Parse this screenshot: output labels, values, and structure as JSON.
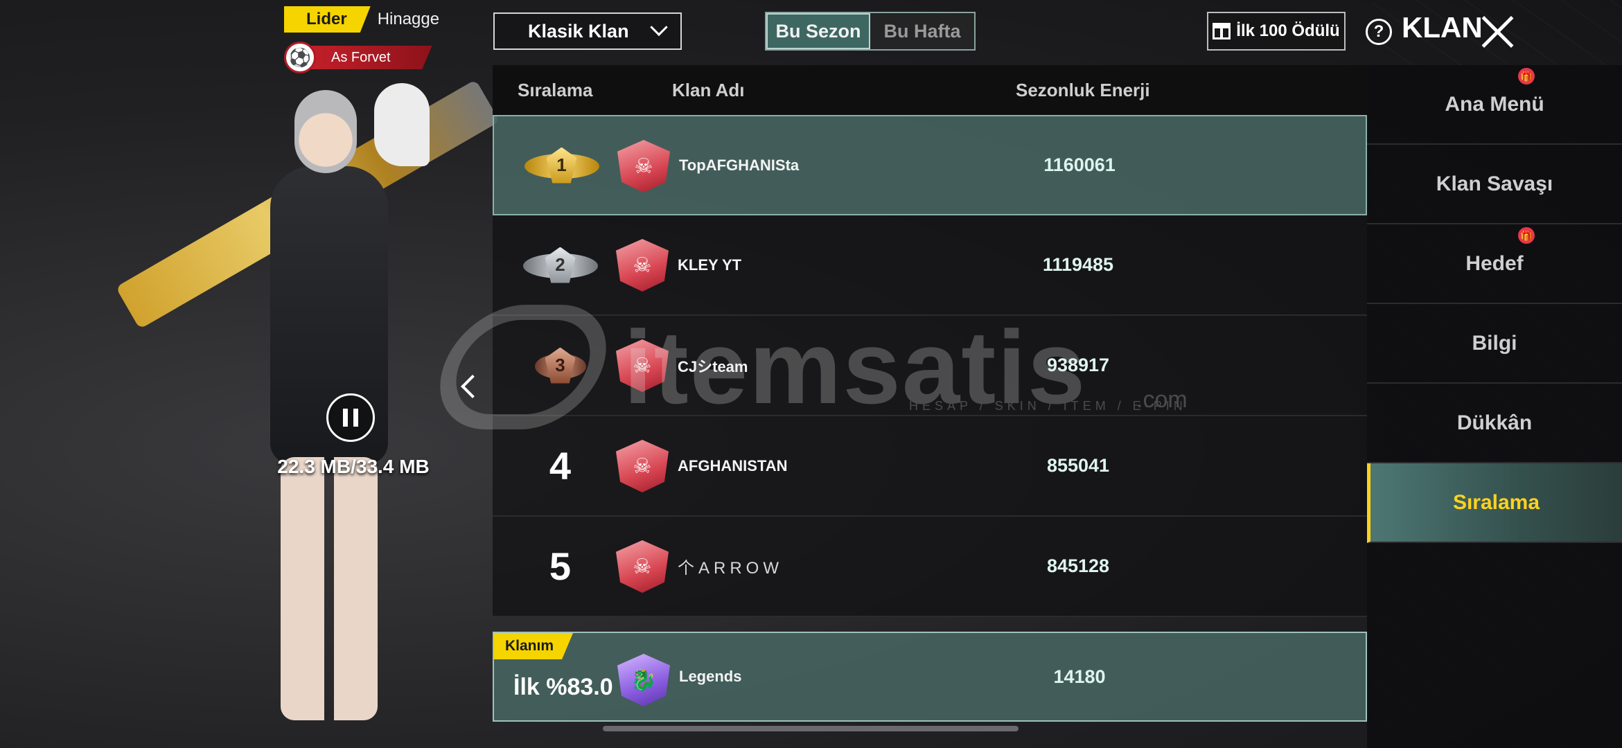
{
  "player": {
    "role_badge": "Lider",
    "name": "Hinagge",
    "position_badge": "As Forvet",
    "download_progress": "22.3 MB/33.4 MB",
    "download_fraction": 0.668
  },
  "controls": {
    "clan_type_selected": "Klasik Klan",
    "tabs": [
      {
        "label": "Bu Sezon",
        "active": true
      },
      {
        "label": "Bu Hafta",
        "active": false
      }
    ],
    "reward_button": "İlk 100 Ödülü",
    "page_title": "KLAN"
  },
  "table": {
    "headers": {
      "rank": "Sıralama",
      "name": "Klan Adı",
      "energy": "Sezonluk Enerji"
    },
    "rows": [
      {
        "rank": "1",
        "medal": "gold",
        "name": "TopAFGHANISta",
        "energy": "1160061"
      },
      {
        "rank": "2",
        "medal": "silver",
        "name": "KLEY  YT",
        "energy": "1119485"
      },
      {
        "rank": "3",
        "medal": "bronze",
        "name": "CJシteam",
        "energy": "938917"
      },
      {
        "rank": "4",
        "name": "AFGHANISTAN",
        "energy": "855041"
      },
      {
        "rank": "5",
        "name": "个ARROW",
        "energy": "845128"
      }
    ]
  },
  "my_clan": {
    "tag": "Klanım",
    "rank": "İlk %83.0",
    "name": "Legends",
    "energy": "14180"
  },
  "sidebar": {
    "items": [
      {
        "label": "Ana Menü",
        "badge": true
      },
      {
        "label": "Klan Savaşı",
        "badge": false
      },
      {
        "label": "Hedef",
        "badge": true
      },
      {
        "label": "Bilgi",
        "badge": false
      },
      {
        "label": "Dükkân",
        "badge": false
      },
      {
        "label": "Sıralama",
        "badge": false,
        "active": true
      }
    ]
  },
  "watermark": {
    "brand": "itemsatis",
    "tagline": "HESAP / SKIN / ITEM / E-PIN",
    "domain": ".com"
  },
  "colors": {
    "accent_yellow": "#f5d400",
    "highlight_teal": "#486763",
    "active_text": "#ffd21e"
  }
}
